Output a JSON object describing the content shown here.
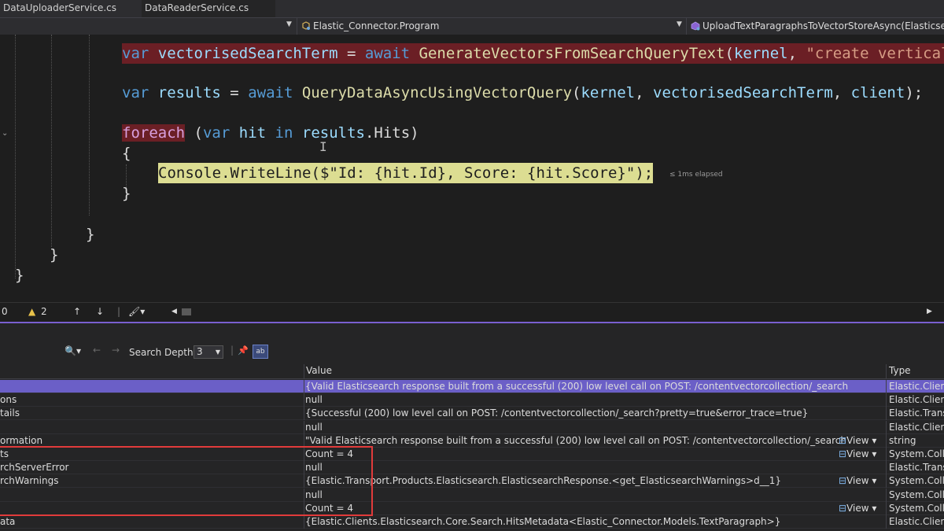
{
  "tabs": [
    "DataUploaderService.cs",
    "DataReaderService.cs"
  ],
  "nav": {
    "class_member": "Elastic_Connector.Program",
    "method_member": "UploadTextParagraphsToVectorStoreAsync(ElasticsearchC"
  },
  "code": {
    "line1_kw": "var",
    "line1_var": "vectorisedSearchTerm",
    "line1_eq": " = ",
    "line1_await": "await",
    "line1_fn": "GenerateVectorsFromSearchQueryText",
    "line1_args_open": "(",
    "line1_arg_kernel": "kernel",
    "line1_comma": ", ",
    "line1_str": "\"create vertical",
    "line2_kw": "var",
    "line2_var": "results",
    "line2_eq": " = ",
    "line2_await": "await",
    "line2_fn": "QueryDataAsyncUsingVectorQuery",
    "line2_open": "(",
    "line2_a1": "kernel",
    "line2_c1": ", ",
    "line2_a2": "vectorisedSearchTerm",
    "line2_c2": ", ",
    "line2_a3": "client",
    "line2_close": ");",
    "line3_foreach": "foreach",
    "line3_open": " (",
    "line3_var": "var",
    "line3_hit": "hit",
    "line3_in": "in",
    "line3_results": "results",
    "line3_rest": ".Hits)",
    "brace_open": "{",
    "line5_cls": "Console",
    "line5_dot": ".",
    "line5_fn": "WriteLine",
    "line5_open": "(",
    "line5_str": "$\"Id: {hit.Id}, Score: {hit.Score}\"",
    "line5_close": ");",
    "elapsed": "≤ 1ms elapsed",
    "brace_close": "}",
    "brace_close2": "}",
    "brace_close3": "}",
    "brace_close4": "}"
  },
  "editor_status": {
    "errors": "0",
    "warnings": "2"
  },
  "autos": {
    "search_depth_label": "Search Depth:",
    "search_depth_value": "3",
    "col_value": "Value",
    "col_type": "Type",
    "view_label": "View",
    "rows": [
      {
        "name": "",
        "value": "{Valid Elasticsearch response built from a successful (200) low level call on POST: /contentvectorcollection/_search?pretty=true&error_t...",
        "type": "Elastic.Clients",
        "view": false
      },
      {
        "name": "ons",
        "value": "null",
        "type": "Elastic.Clients",
        "view": false
      },
      {
        "name": "tails",
        "value": "{Successful (200) low level call on POST: /contentvectorcollection/_search?pretty=true&error_trace=true}",
        "type": "Elastic.Transp",
        "view": false
      },
      {
        "name": "",
        "value": "null",
        "type": "Elastic.Clients",
        "view": false
      },
      {
        "name": "ormation",
        "value": "\"Valid Elasticsearch response built from a successful (200) low level call on POST: /contentvectorcollection/_search?pretty=t...",
        "type": "string",
        "view": true
      },
      {
        "name": "ts",
        "value": "Count = 4",
        "type": "System.Collec",
        "view": true
      },
      {
        "name": "rchServerError",
        "value": "null",
        "type": "Elastic.Transp",
        "view": false
      },
      {
        "name": "rchWarnings",
        "value": "{Elastic.Transport.Products.Elasticsearch.ElasticsearchResponse.<get_ElasticsearchWarnings>d__1}",
        "type": "System.Collec",
        "view": true
      },
      {
        "name": "",
        "value": "null",
        "type": "System.Collec",
        "view": false
      },
      {
        "name": "",
        "value": "Count = 4",
        "type": "System.Collec",
        "view": true
      },
      {
        "name": "ata",
        "value": "{Elastic.Clients.Elasticsearch.Core.Search.HitsMetadata<Elastic_Connector.Models.TextParagraph>}",
        "type": "Elastic.Clients",
        "view": false
      }
    ]
  },
  "colors": {
    "breakpoint_bg": "#6b1f25",
    "current_line_bg": "#dcdd92",
    "selection_row": "#6b5fc7",
    "accent_line": "#7a5fd0",
    "highlight_box": "#e13b3b"
  }
}
